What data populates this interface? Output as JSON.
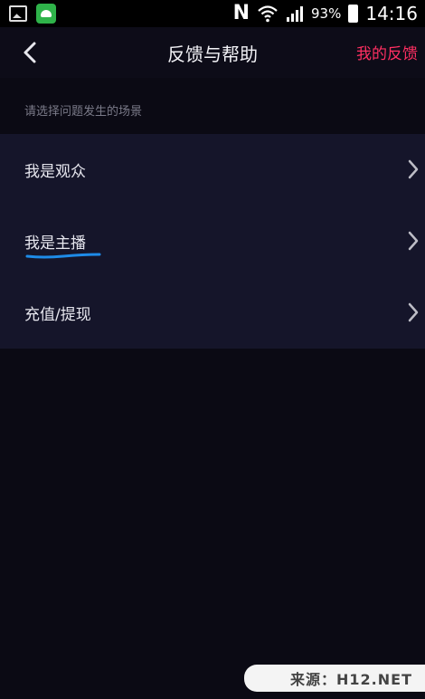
{
  "status_bar": {
    "battery_pct": "93%",
    "time": "14:16",
    "icons": [
      "gallery-icon",
      "app-notification-icon",
      "nfc-icon",
      "wifi-icon",
      "signal-icon",
      "battery-icon"
    ]
  },
  "header": {
    "title": "反馈与帮助",
    "right_action": "我的反馈",
    "back_icon": "chevron-left-icon"
  },
  "section_hint": "请选择问题发生的场景",
  "scenes": [
    {
      "label": "我是观众"
    },
    {
      "label": "我是主播"
    },
    {
      "label": "充值/提现"
    }
  ],
  "watermark": "来源：H12.NET",
  "colors": {
    "accent": "#ff2f62",
    "background": "#0b0a14",
    "list_bg": "#15152a",
    "annotation": "#1e8be8"
  }
}
